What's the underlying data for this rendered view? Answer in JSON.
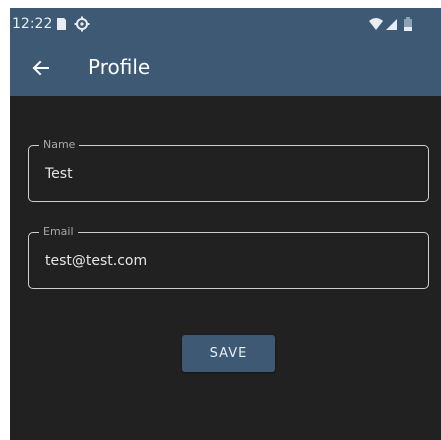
{
  "status_bar": {
    "time": "12:22",
    "icons": [
      "sd-card-icon",
      "settings-icon",
      "wifi-icon",
      "signal-icon",
      "battery-icon"
    ]
  },
  "app_bar": {
    "title": "Profile",
    "back_icon": "arrow-back-icon"
  },
  "form": {
    "name": {
      "label": "Name",
      "value": "Test"
    },
    "email": {
      "label": "Email",
      "value": "test@test.com"
    }
  },
  "actions": {
    "save_label": "SAVE"
  },
  "colors": {
    "primary": "#3d5973",
    "background": "#212121",
    "border": "#cfcfcf"
  }
}
